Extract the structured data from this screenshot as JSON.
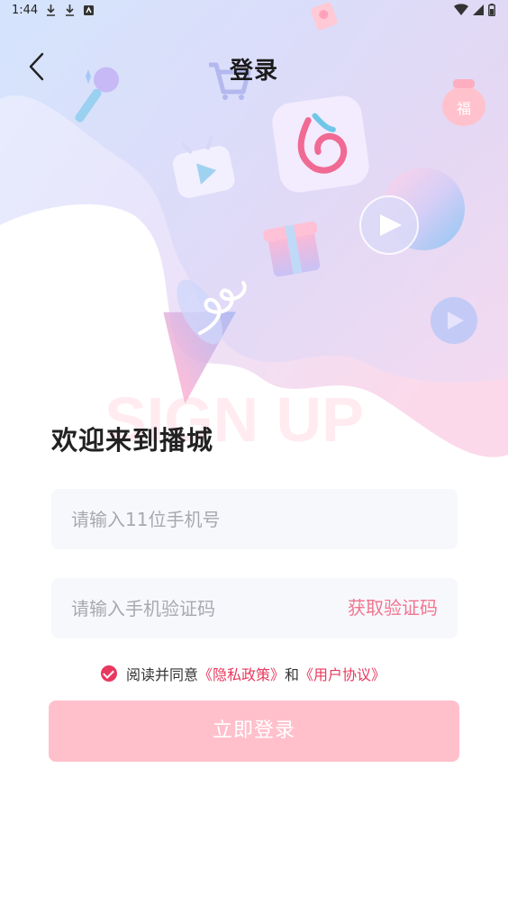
{
  "status_bar": {
    "time": "1:44"
  },
  "header": {
    "title": "登录"
  },
  "hero": {
    "watermark": "SIGN UP"
  },
  "welcome": "欢迎来到播城",
  "phone_field": {
    "placeholder": "请输入11位手机号",
    "value": ""
  },
  "code_field": {
    "placeholder": "请输入手机验证码",
    "value": "",
    "get_code_label": "获取验证码"
  },
  "agreement": {
    "prefix": "阅读并同意",
    "privacy_link": "《隐私政策》",
    "connector": "和",
    "terms_link": "《用户协议》",
    "checked": true
  },
  "login_button": {
    "label": "立即登录"
  },
  "colors": {
    "accent": "#e8385e",
    "button": "#ffc0cc",
    "field_bg": "#f7f8fc"
  }
}
